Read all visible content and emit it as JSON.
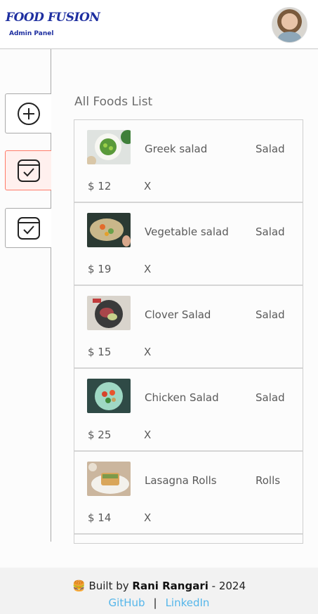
{
  "navbar": {
    "logo_title": "FOOD FUSION",
    "logo_sub": "Admin Panel",
    "avatar_icon": "profile-avatar"
  },
  "sidebar": {
    "items": [
      {
        "icon": "add-circle-icon",
        "active": false
      },
      {
        "icon": "list-check-icon",
        "active": true
      },
      {
        "icon": "orders-check-icon",
        "active": false
      }
    ],
    "accent_color": "#ff7a68"
  },
  "main": {
    "title": "All Foods List",
    "foods": [
      {
        "name": "Greek salad",
        "category": "Salad",
        "price": "$ 12",
        "remove": "X"
      },
      {
        "name": "Vegetable salad",
        "category": "Salad",
        "price": "$ 19",
        "remove": "X"
      },
      {
        "name": "Clover Salad",
        "category": "Salad",
        "price": "$ 15",
        "remove": "X"
      },
      {
        "name": "Chicken Salad",
        "category": "Salad",
        "price": "$ 25",
        "remove": "X"
      },
      {
        "name": "Lasagna Rolls",
        "category": "Rolls",
        "price": "$ 14",
        "remove": "X"
      }
    ]
  },
  "footer": {
    "emoji": "🍔",
    "built_by": "Built by",
    "author": "Rani Rangari",
    "year_text": "- 2024",
    "github": "GitHub",
    "separator": "|",
    "linkedin": "LinkedIn",
    "link_color": "#55b6ea"
  }
}
